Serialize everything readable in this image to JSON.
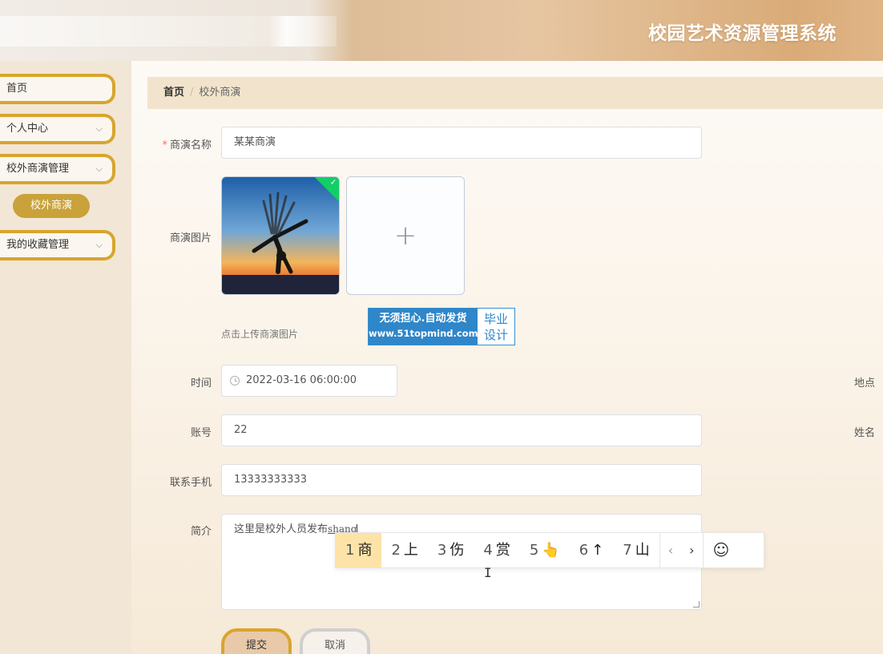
{
  "header": {
    "title": "校园艺术资源管理系统"
  },
  "sidebar": {
    "items": [
      {
        "label": "首页",
        "has_chevron": false
      },
      {
        "label": "个人中心",
        "has_chevron": true
      },
      {
        "label": "校外商演管理",
        "has_chevron": true
      },
      {
        "label": "我的收藏管理",
        "has_chevron": true
      }
    ],
    "active_submenu": "校外商演",
    "chevron_icon": "⌵"
  },
  "breadcrumb": {
    "home": "首页",
    "separator": "/",
    "current": "校外商演"
  },
  "form": {
    "name": {
      "label": "商演名称",
      "required_mark": "*",
      "value": "某某商演"
    },
    "image": {
      "label": "商演图片",
      "tip": "点击上传商演图片",
      "add_icon": "+",
      "check_icon": "✓"
    },
    "time": {
      "label": "时间",
      "value": "2022-03-16 06:00:00"
    },
    "location": {
      "label": "地点"
    },
    "account": {
      "label": "账号",
      "value": "22"
    },
    "realname": {
      "label": "姓名"
    },
    "phone": {
      "label": "联系手机",
      "value": "13333333333"
    },
    "intro": {
      "label": "简介",
      "value": "这里是校外人员发布",
      "composing": "shang"
    },
    "submit_label": "提交",
    "cancel_label": "取消"
  },
  "watermark": {
    "text_top": "无须担心.自动发货",
    "text_url": "www.51topmind.com",
    "text_right_1": "毕业",
    "text_right_2": "设计",
    "color": "#2f86c8"
  },
  "ime": {
    "candidates": [
      {
        "num": "1",
        "text": "商"
      },
      {
        "num": "2",
        "text": "上"
      },
      {
        "num": "3",
        "text": "伤"
      },
      {
        "num": "4",
        "text": "赏"
      },
      {
        "num": "5",
        "text": "👆"
      },
      {
        "num": "6",
        "text": "↑"
      },
      {
        "num": "7",
        "text": "山"
      }
    ],
    "prev_icon": "‹",
    "next_icon": "›",
    "emoji_icon": "☺"
  },
  "colors": {
    "accent": "#d8a52d",
    "submenu_active": "#c9a23a",
    "breadcrumb_bg": "#f2e4cc"
  }
}
